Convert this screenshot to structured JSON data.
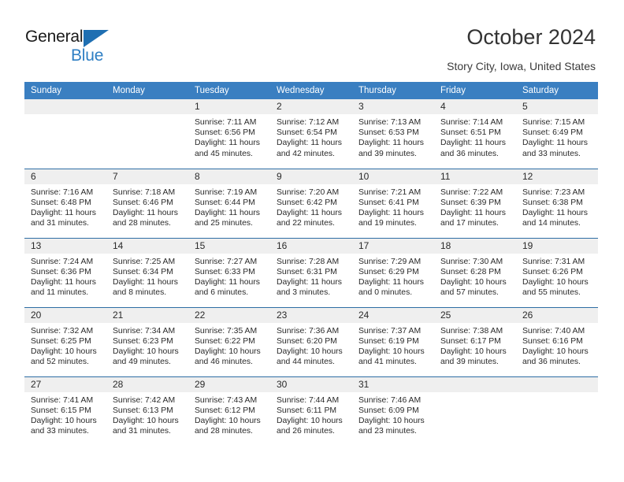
{
  "brand": {
    "name_top": "General",
    "name_bottom": "Blue",
    "accent_color": "#2f7fc4",
    "triangle_color": "#1f6fb2"
  },
  "header": {
    "title": "October 2024",
    "subtitle": "Story City, Iowa, United States"
  },
  "theme": {
    "header_row_bg": "#3a7fc1",
    "header_row_text": "#ffffff",
    "daynum_bg": "#efefef",
    "week_divider": "#2e6da4"
  },
  "weekdays": [
    "Sunday",
    "Monday",
    "Tuesday",
    "Wednesday",
    "Thursday",
    "Friday",
    "Saturday"
  ],
  "labels": {
    "sunrise_prefix": "Sunrise:",
    "sunset_prefix": "Sunset:",
    "daylight_prefix": "Daylight:"
  },
  "weeks": [
    [
      {
        "day": "",
        "empty": true
      },
      {
        "day": "",
        "empty": true
      },
      {
        "day": "1",
        "sunrise": "Sunrise: 7:11 AM",
        "sunset": "Sunset: 6:56 PM",
        "daylight": "Daylight: 11 hours and 45 minutes."
      },
      {
        "day": "2",
        "sunrise": "Sunrise: 7:12 AM",
        "sunset": "Sunset: 6:54 PM",
        "daylight": "Daylight: 11 hours and 42 minutes."
      },
      {
        "day": "3",
        "sunrise": "Sunrise: 7:13 AM",
        "sunset": "Sunset: 6:53 PM",
        "daylight": "Daylight: 11 hours and 39 minutes."
      },
      {
        "day": "4",
        "sunrise": "Sunrise: 7:14 AM",
        "sunset": "Sunset: 6:51 PM",
        "daylight": "Daylight: 11 hours and 36 minutes."
      },
      {
        "day": "5",
        "sunrise": "Sunrise: 7:15 AM",
        "sunset": "Sunset: 6:49 PM",
        "daylight": "Daylight: 11 hours and 33 minutes."
      }
    ],
    [
      {
        "day": "6",
        "sunrise": "Sunrise: 7:16 AM",
        "sunset": "Sunset: 6:48 PM",
        "daylight": "Daylight: 11 hours and 31 minutes."
      },
      {
        "day": "7",
        "sunrise": "Sunrise: 7:18 AM",
        "sunset": "Sunset: 6:46 PM",
        "daylight": "Daylight: 11 hours and 28 minutes."
      },
      {
        "day": "8",
        "sunrise": "Sunrise: 7:19 AM",
        "sunset": "Sunset: 6:44 PM",
        "daylight": "Daylight: 11 hours and 25 minutes."
      },
      {
        "day": "9",
        "sunrise": "Sunrise: 7:20 AM",
        "sunset": "Sunset: 6:42 PM",
        "daylight": "Daylight: 11 hours and 22 minutes."
      },
      {
        "day": "10",
        "sunrise": "Sunrise: 7:21 AM",
        "sunset": "Sunset: 6:41 PM",
        "daylight": "Daylight: 11 hours and 19 minutes."
      },
      {
        "day": "11",
        "sunrise": "Sunrise: 7:22 AM",
        "sunset": "Sunset: 6:39 PM",
        "daylight": "Daylight: 11 hours and 17 minutes."
      },
      {
        "day": "12",
        "sunrise": "Sunrise: 7:23 AM",
        "sunset": "Sunset: 6:38 PM",
        "daylight": "Daylight: 11 hours and 14 minutes."
      }
    ],
    [
      {
        "day": "13",
        "sunrise": "Sunrise: 7:24 AM",
        "sunset": "Sunset: 6:36 PM",
        "daylight": "Daylight: 11 hours and 11 minutes."
      },
      {
        "day": "14",
        "sunrise": "Sunrise: 7:25 AM",
        "sunset": "Sunset: 6:34 PM",
        "daylight": "Daylight: 11 hours and 8 minutes."
      },
      {
        "day": "15",
        "sunrise": "Sunrise: 7:27 AM",
        "sunset": "Sunset: 6:33 PM",
        "daylight": "Daylight: 11 hours and 6 minutes."
      },
      {
        "day": "16",
        "sunrise": "Sunrise: 7:28 AM",
        "sunset": "Sunset: 6:31 PM",
        "daylight": "Daylight: 11 hours and 3 minutes."
      },
      {
        "day": "17",
        "sunrise": "Sunrise: 7:29 AM",
        "sunset": "Sunset: 6:29 PM",
        "daylight": "Daylight: 11 hours and 0 minutes."
      },
      {
        "day": "18",
        "sunrise": "Sunrise: 7:30 AM",
        "sunset": "Sunset: 6:28 PM",
        "daylight": "Daylight: 10 hours and 57 minutes."
      },
      {
        "day": "19",
        "sunrise": "Sunrise: 7:31 AM",
        "sunset": "Sunset: 6:26 PM",
        "daylight": "Daylight: 10 hours and 55 minutes."
      }
    ],
    [
      {
        "day": "20",
        "sunrise": "Sunrise: 7:32 AM",
        "sunset": "Sunset: 6:25 PM",
        "daylight": "Daylight: 10 hours and 52 minutes."
      },
      {
        "day": "21",
        "sunrise": "Sunrise: 7:34 AM",
        "sunset": "Sunset: 6:23 PM",
        "daylight": "Daylight: 10 hours and 49 minutes."
      },
      {
        "day": "22",
        "sunrise": "Sunrise: 7:35 AM",
        "sunset": "Sunset: 6:22 PM",
        "daylight": "Daylight: 10 hours and 46 minutes."
      },
      {
        "day": "23",
        "sunrise": "Sunrise: 7:36 AM",
        "sunset": "Sunset: 6:20 PM",
        "daylight": "Daylight: 10 hours and 44 minutes."
      },
      {
        "day": "24",
        "sunrise": "Sunrise: 7:37 AM",
        "sunset": "Sunset: 6:19 PM",
        "daylight": "Daylight: 10 hours and 41 minutes."
      },
      {
        "day": "25",
        "sunrise": "Sunrise: 7:38 AM",
        "sunset": "Sunset: 6:17 PM",
        "daylight": "Daylight: 10 hours and 39 minutes."
      },
      {
        "day": "26",
        "sunrise": "Sunrise: 7:40 AM",
        "sunset": "Sunset: 6:16 PM",
        "daylight": "Daylight: 10 hours and 36 minutes."
      }
    ],
    [
      {
        "day": "27",
        "sunrise": "Sunrise: 7:41 AM",
        "sunset": "Sunset: 6:15 PM",
        "daylight": "Daylight: 10 hours and 33 minutes."
      },
      {
        "day": "28",
        "sunrise": "Sunrise: 7:42 AM",
        "sunset": "Sunset: 6:13 PM",
        "daylight": "Daylight: 10 hours and 31 minutes."
      },
      {
        "day": "29",
        "sunrise": "Sunrise: 7:43 AM",
        "sunset": "Sunset: 6:12 PM",
        "daylight": "Daylight: 10 hours and 28 minutes."
      },
      {
        "day": "30",
        "sunrise": "Sunrise: 7:44 AM",
        "sunset": "Sunset: 6:11 PM",
        "daylight": "Daylight: 10 hours and 26 minutes."
      },
      {
        "day": "31",
        "sunrise": "Sunrise: 7:46 AM",
        "sunset": "Sunset: 6:09 PM",
        "daylight": "Daylight: 10 hours and 23 minutes."
      },
      {
        "day": "",
        "empty": true
      },
      {
        "day": "",
        "empty": true
      }
    ]
  ]
}
